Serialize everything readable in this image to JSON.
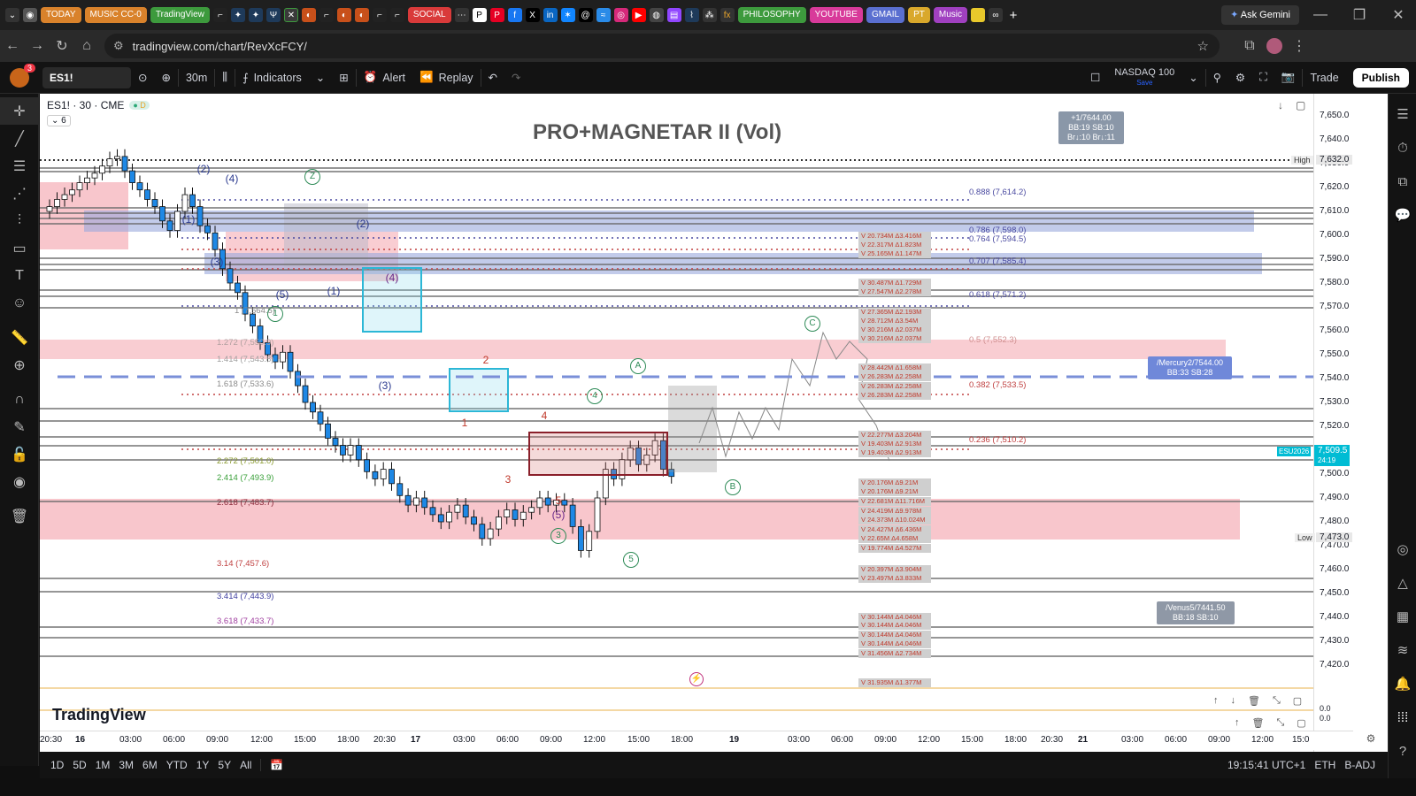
{
  "browser": {
    "tabs": [
      {
        "label": "TODAY",
        "color": "#d9822b"
      },
      {
        "label": "MUSIC CC-0",
        "color": "#d9822b"
      },
      {
        "label": "TradingView",
        "color": "#3d9a3d"
      },
      {
        "label": "SOCIAL",
        "color": "#d93a3a"
      },
      {
        "label": "PHILOSOPHY",
        "color": "#3d9a3d"
      },
      {
        "label": "YOUTUBE",
        "color": "#d83a9a"
      },
      {
        "label": "GMAIL",
        "color": "#5a6fd0"
      },
      {
        "label": "PT",
        "color": "#d9a82b"
      },
      {
        "label": "Music",
        "color": "#a040c0"
      }
    ],
    "gemini_label": "Ask Gemini",
    "url": "tradingview.com/chart/RevXcFCY/"
  },
  "toolbar": {
    "avatar_badge": "3",
    "symbol": "ES1!",
    "interval": "30m",
    "indicators_label": "Indicators",
    "alert_label": "Alert",
    "replay_label": "Replay",
    "compare_symbol": "NASDAQ 100",
    "compare_sub": "Save",
    "trade_label": "Trade",
    "publish_label": "Publish"
  },
  "legend": {
    "title": "ES1! · 30 · CME",
    "collapse_count": "6",
    "chart_title": "PRO+MAGNETAR II (Vol)"
  },
  "price_axis": {
    "ticks": [
      "7,650.0",
      "7,640.0",
      "7,630.0",
      "7,620.0",
      "7,610.0",
      "7,600.0",
      "7,590.0",
      "7,580.0",
      "7,570.0",
      "7,560.0",
      "7,550.0",
      "7,540.0",
      "7,530.0",
      "7,520.0",
      "7,510.0",
      "7,500.0",
      "7,490.0",
      "7,480.0",
      "7,470.0",
      "7,460.0",
      "7,450.0",
      "7,440.0",
      "7,430.0",
      "7,420.0"
    ],
    "high_label": "High",
    "high_value": "7,632.0",
    "low_label": "Low",
    "low_value": "7,473.0",
    "last_symbol": "ESU2026",
    "last_price": "7,509.5",
    "last_countdown": "24:19",
    "pane_zero_1": "0.0",
    "pane_zero_2": "0.0"
  },
  "time_axis": {
    "ticks": [
      "20:30",
      "16",
      "03:00",
      "06:00",
      "09:00",
      "12:00",
      "15:00",
      "18:00",
      "20:30",
      "17",
      "03:00",
      "06:00",
      "09:00",
      "12:00",
      "15:00",
      "18:00",
      "19",
      "03:00",
      "06:00",
      "09:00",
      "12:00",
      "15:00",
      "18:00",
      "20:30",
      "21",
      "03:00",
      "06:00",
      "09:00",
      "12:00",
      "15:0"
    ]
  },
  "fib_left": [
    {
      "label": "1 (7,564.5)",
      "color": "#8a8a8a"
    },
    {
      "label": "1.272 (7,550.9)",
      "color": "#b0a0a0"
    },
    {
      "label": "1.414 (7,543.8)",
      "color": "#a0a0a0"
    },
    {
      "label": "1.618 (7,533.6)",
      "color": "#8a8a8a"
    },
    {
      "label": "2.272 (7,501.0)",
      "color": "#8a9a30"
    },
    {
      "label": "2.414 (7,493.9)",
      "color": "#3aa03a"
    },
    {
      "label": "2.618 (7,483.7)",
      "color": "#8a2a3a"
    },
    {
      "label": "3.14 (7,457.6)",
      "color": "#c04040"
    },
    {
      "label": "3.414 (7,443.9)",
      "color": "#4040a0"
    },
    {
      "label": "3.618 (7,433.7)",
      "color": "#a040a0"
    }
  ],
  "fib_right": [
    {
      "label": "0.888 (7,614.2)",
      "color": "#4a4aa0"
    },
    {
      "label": "0.786 (7,598.0)",
      "color": "#4a4aa0"
    },
    {
      "label": "0.764 (7,594.5)",
      "color": "#4a4aa0"
    },
    {
      "label": "0.707 (7,585.4)",
      "color": "#4a4aa0"
    },
    {
      "label": "0.618 (7,571.2)",
      "color": "#4a4aa0"
    },
    {
      "label": "0.5 (7,552.3)",
      "color": "#d09090"
    },
    {
      "label": "0.382 (7,533.5)",
      "color": "#c04040"
    },
    {
      "label": "0.236 (7,510.2)",
      "color": "#c04040"
    }
  ],
  "volume_labels": [
    "V 20.734M Δ3.416M",
    "V 22.317M Δ1.823M",
    "V 25.165M Δ1.147M",
    "V 30.487M Δ1.729M",
    "V 27.547M Δ2.278M",
    "V 27.365M Δ2.193M",
    "V 28.712M Δ3.54M",
    "V 30.216M Δ2.037M",
    "V 30.216M Δ2.037M",
    "V 28.442M Δ1.658M",
    "V 26.283M Δ2.258M",
    "V 26.283M Δ2.258M",
    "V 26.283M Δ2.258M",
    "V 22.277M Δ3.204M",
    "V 19.403M Δ2.913M",
    "V 19.403M Δ2.913M",
    "V 20.176M Δ9.21M",
    "V 20.176M Δ9.21M",
    "V 22.681M Δ11.716M",
    "V 24.419M Δ9.978M",
    "V 24.373M Δ10.024M",
    "V 24.427M Δ6.436M",
    "V 22.65M Δ4.658M",
    "V 19.774M Δ4.527M",
    "V 20.397M Δ3.904M",
    "V 23.497M Δ3.833M",
    "V 30.144M Δ4.046M",
    "V 30.144M Δ4.046M",
    "V 30.144M Δ4.046M",
    "V 30.144M Δ4.046M",
    "V 31.456M Δ2.734M",
    "V 31.935M Δ1.377M"
  ],
  "callouts": {
    "top": {
      "line1": "+1/7644.00",
      "line2": "BB:19  SB:10",
      "line3": "Br↓:10  Br↓:11"
    },
    "mercury": {
      "line1": "/Mercury2/7544.00",
      "line2": "BB:33  SB:28"
    },
    "venus": {
      "line1": "/Venus5/7441.50",
      "line2": "BB:18  SB:10"
    }
  },
  "waves": {
    "wZ": "Z",
    "w2a": "(2)",
    "w4a": "(4)",
    "w1a": "(1)",
    "w3a": "(3)",
    "w5a": "(5)",
    "w1b": "(1)",
    "w2b": "(2)",
    "w4b": "(4)",
    "w1c": "1",
    "w3b": "(3)",
    "n2": "2",
    "n1": "1",
    "n4": "4",
    "n3": "3",
    "n5": "5",
    "w5b": "(5)",
    "c3": "3",
    "cA": "A",
    "c4": "4",
    "c5": "5",
    "cB": "B",
    "cC": "C"
  },
  "bottom": {
    "ranges": [
      "1D",
      "5D",
      "1M",
      "3M",
      "6M",
      "YTD",
      "1Y",
      "5Y",
      "All"
    ],
    "time": "19:15:41 UTC+1",
    "session": "ETH",
    "adj": "B-ADJ"
  },
  "brand": "TradingView",
  "colors": {
    "accent": "#2962ff",
    "up": "#26a69a",
    "down": "#ef5350",
    "candle_body": "#1e88e5",
    "zone_red": "#f8c6cc",
    "zone_blue": "#8fa0d8",
    "cyan_box": "#2cb7d6"
  }
}
